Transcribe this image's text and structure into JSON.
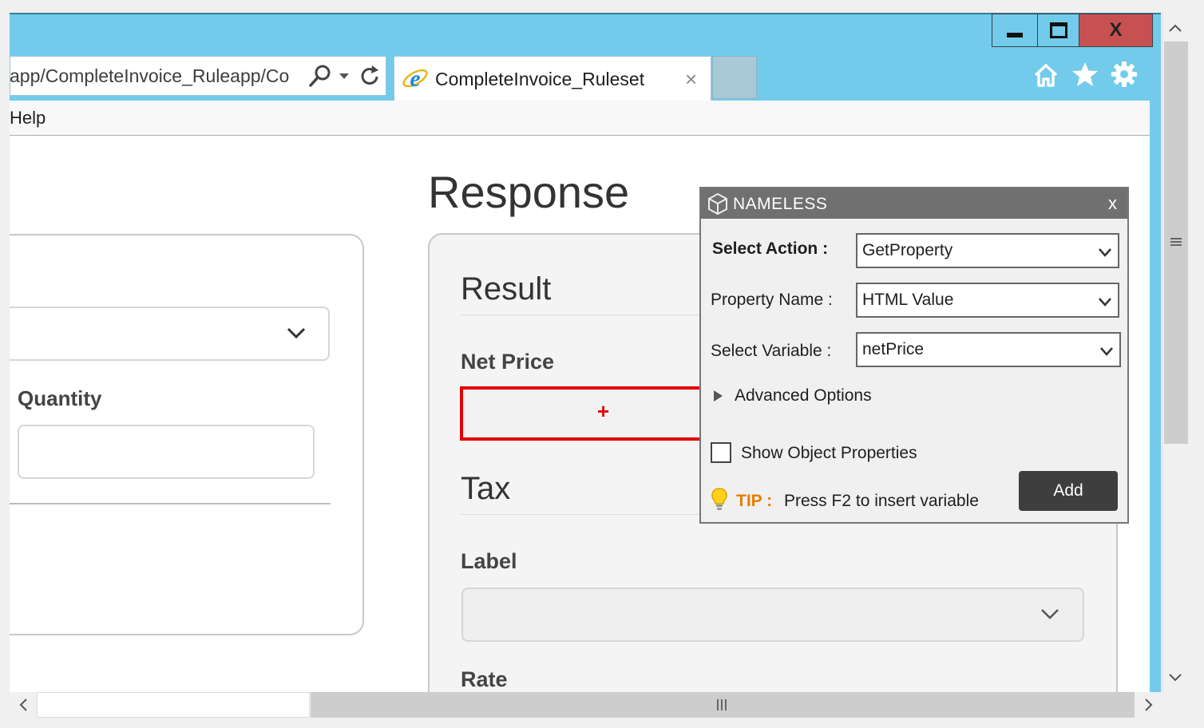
{
  "browser": {
    "address": "app/CompleteInvoice_Ruleapp/Co",
    "tab_title": "CompleteInvoice_Ruleset",
    "tab_close": "×",
    "close_glyph": "X",
    "menu": {
      "help": "Help"
    }
  },
  "page": {
    "left_panel": {
      "quantity_label": "Quantity"
    },
    "response_title": "Response",
    "result_heading": "Result",
    "net_price_label": "Net Price",
    "add_glyph": "+",
    "tax_heading": "Tax",
    "label_label": "Label",
    "rate_label": "Rate"
  },
  "popup": {
    "title": "NAMELESS",
    "close": "x",
    "select_action_label": "Select Action :",
    "select_action_value": "GetProperty",
    "property_name_label": "Property Name :",
    "property_name_value": "HTML Value",
    "select_variable_label": "Select Variable :",
    "select_variable_value": "netPrice",
    "advanced_options": "Advanced Options",
    "show_object_properties": "Show Object Properties",
    "show_object_properties_checked": false,
    "tip_label": "TIP :",
    "tip_text": "Press F2 to insert variable",
    "add_button": "Add"
  },
  "colors": {
    "window_frame": "#72cbea",
    "close_button": "#c75050",
    "highlight_border": "#e10000",
    "tip_color": "#e87d00",
    "popup_titlebar": "#707070",
    "add_button": "#3e3e3e"
  }
}
